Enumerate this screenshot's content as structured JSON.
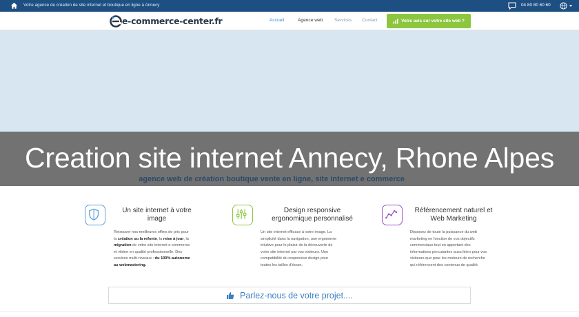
{
  "topbar": {
    "tagline": "Votre agence de création de site internet et boutique en ligne à Annecy",
    "phone": "04 80 80 60 60",
    "icons": [
      "home-icon",
      "chat-icon",
      "globe-icon",
      "caret-down-icon"
    ]
  },
  "nav": {
    "logo": "e-commerce-center.fr",
    "items": [
      "Accueil",
      "Agence web",
      "Services",
      "Contact"
    ],
    "cta_label": "Votre avis sur votre site web ?",
    "colors": {
      "topbar": "#1d4f82",
      "cta": "#8cc63f",
      "active": "#3b8ad8"
    }
  },
  "hero": {
    "title": "Creation site internet Annecy, Rhone Alpes",
    "subtitle": "agence web de création boutique vente en ligne, site internet e commerce"
  },
  "features": [
    {
      "icon": "shield-icon",
      "title": [
        "Un site internet à votre",
        "image"
      ],
      "text": [
        [
          "Retrouver nos meilleures offres de prix pour"
        ],
        [
          "la ",
          {
            "b": "création ou la refonte"
          },
          ", la ",
          {
            "b": "mise à jour"
          },
          ", la"
        ],
        [
          {
            "b": "migration"
          },
          " de votre site internet e-commerce"
        ],
        [
          "et vitrine en qualité professionnelle. Des"
        ],
        [
          "services multi-niveaux :  ",
          {
            "b": "du 100% autonome"
          }
        ],
        [
          {
            "b": "au webmastering."
          }
        ]
      ]
    },
    {
      "icon": "sliders-icon",
      "title": [
        "Design responsive",
        "ergonomique personnalisé"
      ],
      "text": [
        [
          "Un site internet efficace à votre image. La"
        ],
        [
          "simplicité dans la navigation, une ergonomie"
        ],
        [
          "intuitive pour le plaisir de la découverte de"
        ],
        [
          "votre site internet par vos visiteurs. Une"
        ],
        [
          "compatibilité du responsive design pour"
        ],
        [
          "toutes les tailles d'écran."
        ]
      ]
    },
    {
      "icon": "line-chart-icon",
      "title": [
        "Référencement naturel et",
        "Web Marketing"
      ],
      "text": [
        [
          "Disposez de toute la puissance du web"
        ],
        [
          "marketing en fonction de vos objectifs"
        ],
        [
          "commerciaux tout en apportant des"
        ],
        [
          "informations percutantes aussi bien pour vos"
        ],
        [
          "visiteurs que pour les moteurs de recherche"
        ],
        [
          "qui référencent des contenus de qualité."
        ]
      ]
    }
  ],
  "contact": {
    "label": "Parlez-nous de votre projet....",
    "icon": "thumbs-up-icon"
  }
}
